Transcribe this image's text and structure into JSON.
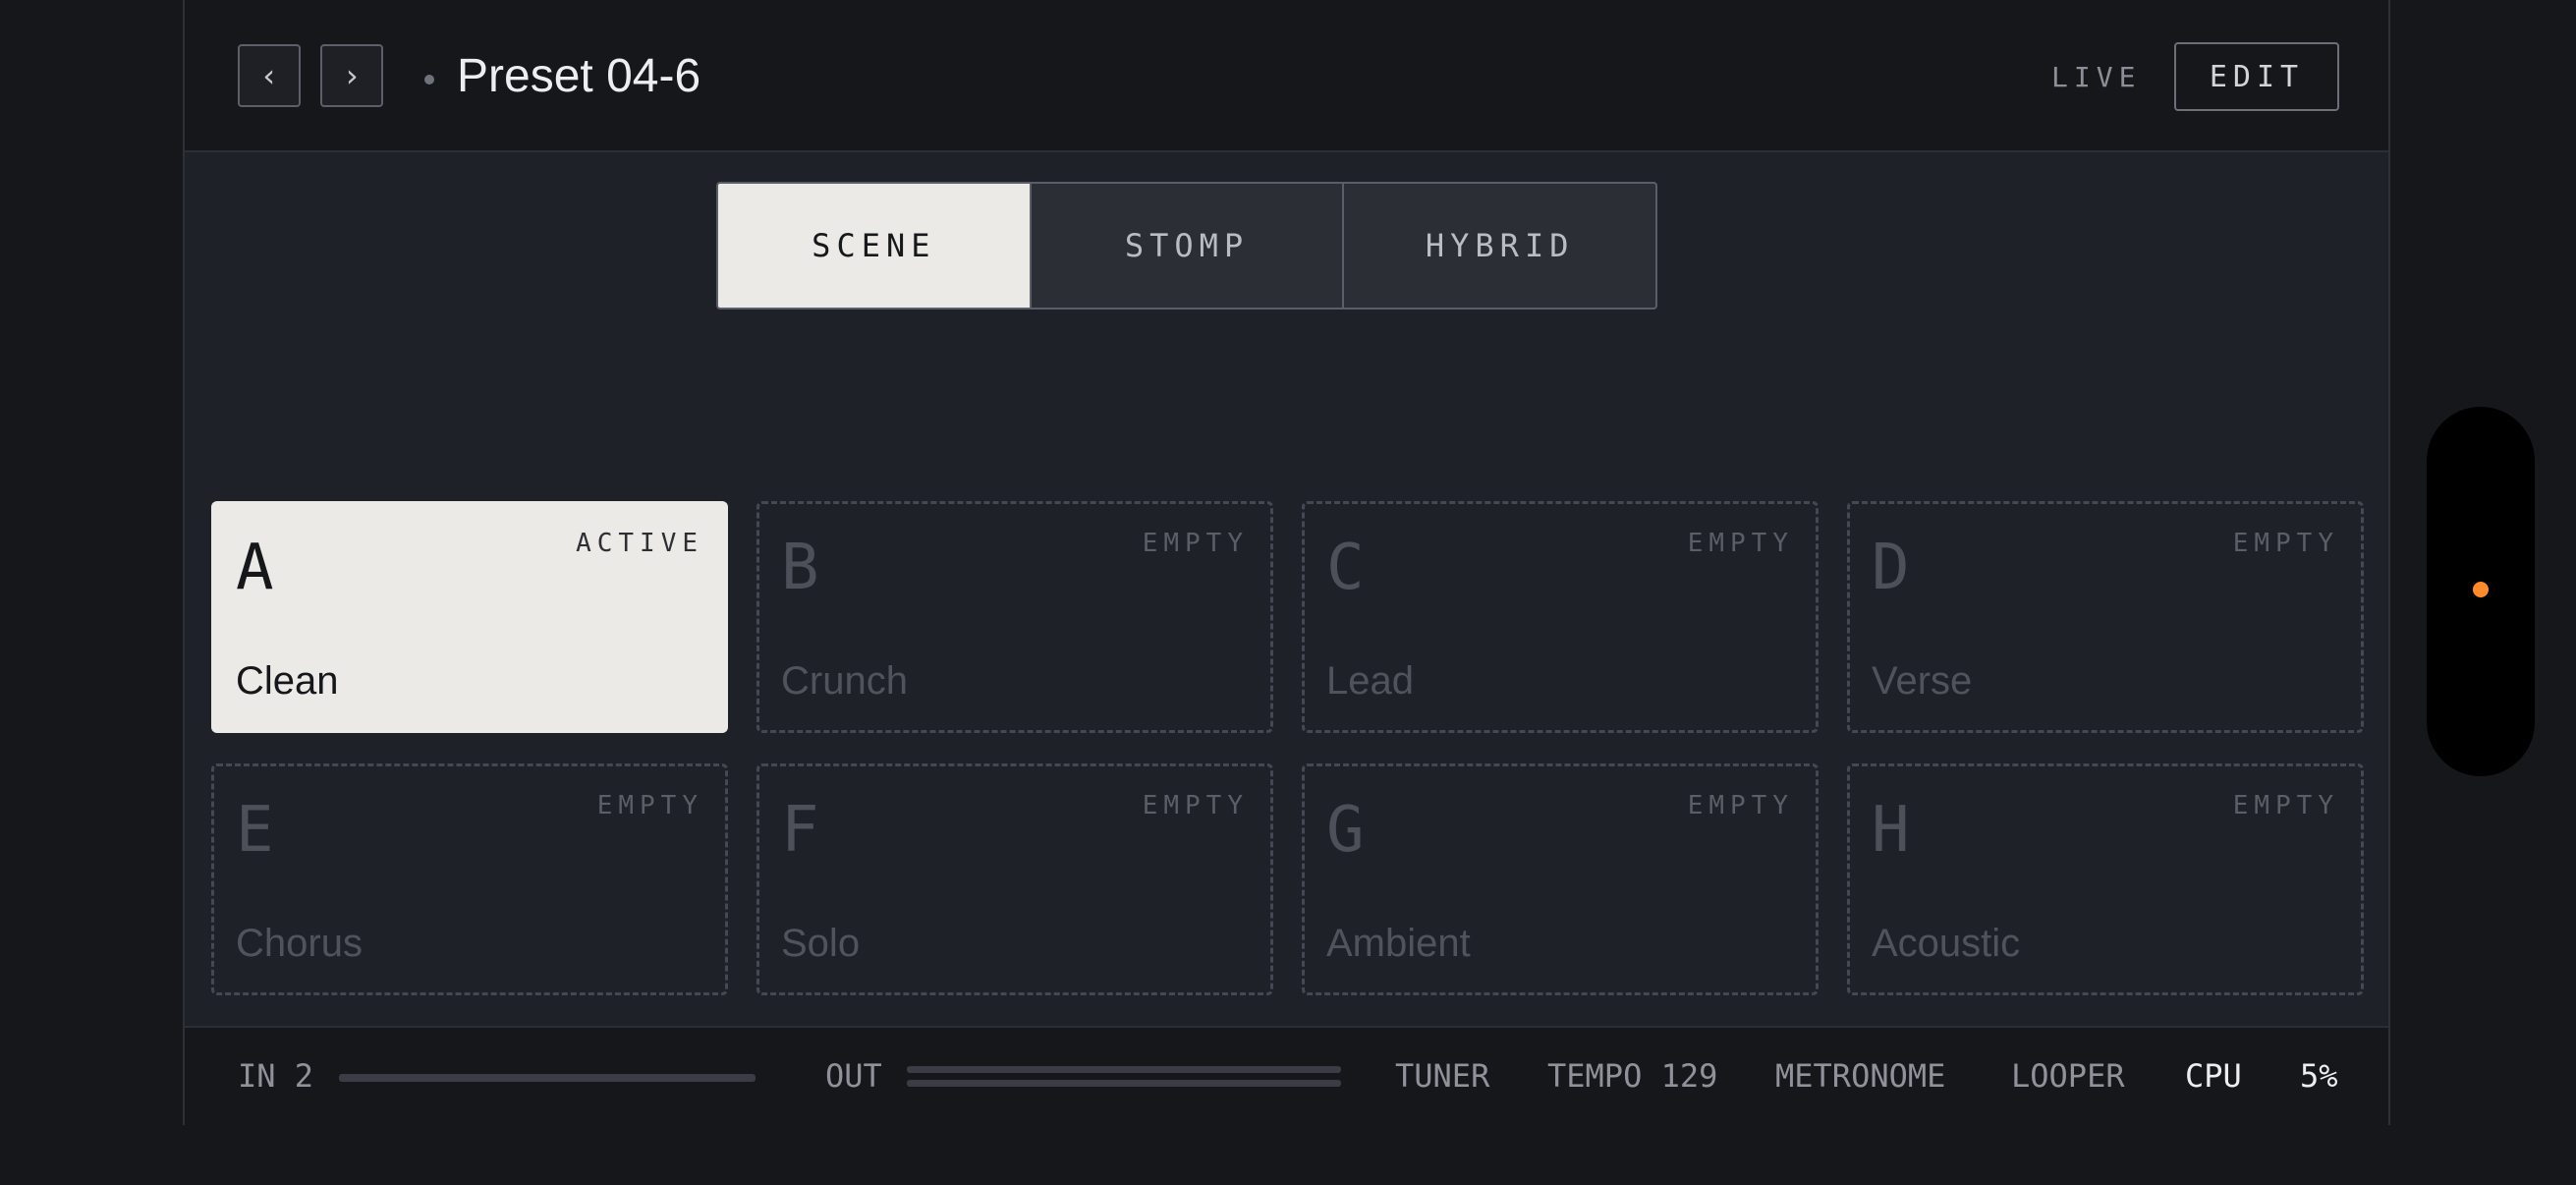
{
  "header": {
    "prev_label": "‹",
    "next_label": "›",
    "preset_name": "Preset 04-6",
    "live_label": "LIVE",
    "edit_label": "EDIT"
  },
  "modes": [
    {
      "label": "SCENE",
      "active": true
    },
    {
      "label": "STOMP",
      "active": false
    },
    {
      "label": "HYBRID",
      "active": false
    }
  ],
  "scenes": [
    {
      "letter": "A",
      "status": "ACTIVE",
      "name": "Clean"
    },
    {
      "letter": "B",
      "status": "EMPTY",
      "name": "Crunch"
    },
    {
      "letter": "C",
      "status": "EMPTY",
      "name": "Lead"
    },
    {
      "letter": "D",
      "status": "EMPTY",
      "name": "Verse"
    },
    {
      "letter": "E",
      "status": "EMPTY",
      "name": "Chorus"
    },
    {
      "letter": "F",
      "status": "EMPTY",
      "name": "Solo"
    },
    {
      "letter": "G",
      "status": "EMPTY",
      "name": "Ambient"
    },
    {
      "letter": "H",
      "status": "EMPTY",
      "name": "Acoustic"
    }
  ],
  "footer": {
    "in_label": "IN 2",
    "out_label": "OUT",
    "tuner_label": "TUNER",
    "tempo_label": "TEMPO 129",
    "metronome_label": "METRONOME",
    "looper_label": "LOOPER",
    "cpu_label": "CPU",
    "cpu_value": "5%"
  },
  "colors": {
    "accent_dot": "#ff8a2a",
    "active_card": "#ebeae6",
    "background": "#1f2129"
  }
}
